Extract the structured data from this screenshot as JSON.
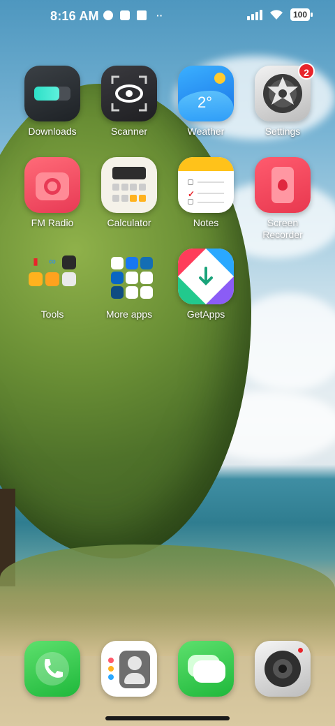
{
  "status_bar": {
    "time": "8:16 AM",
    "battery": "100",
    "notification_icons": [
      "vpn-icon",
      "image-icon",
      "upload-icon"
    ],
    "more_indicator": "··"
  },
  "apps": {
    "downloads": {
      "label": "Downloads",
      "color": "#2b2f33"
    },
    "scanner": {
      "label": "Scanner",
      "color": "#2a2a2e"
    },
    "weather": {
      "label": "Weather",
      "temp": "2°",
      "color": "#1e90ff"
    },
    "settings": {
      "label": "Settings",
      "badge": "2",
      "color": "#d9d9d9"
    },
    "fm_radio": {
      "label": "FM Radio",
      "color": "#f0475a"
    },
    "calculator": {
      "label": "Calculator",
      "color": "#f4f1e8"
    },
    "notes": {
      "label": "Notes",
      "color": "#ffffff"
    },
    "screen_recorder": {
      "label": "Screen Recorder",
      "color": "#f0475a"
    },
    "tools": {
      "label": "Tools"
    },
    "more_apps": {
      "label": "More apps"
    },
    "getapps": {
      "label": "GetApps"
    }
  },
  "dock": {
    "phone": {
      "color": "#35c94f"
    },
    "contacts": {
      "color": "#ffffff"
    },
    "messages": {
      "color": "#35c94f"
    },
    "camera": {
      "color": "#e6e6e6"
    }
  }
}
